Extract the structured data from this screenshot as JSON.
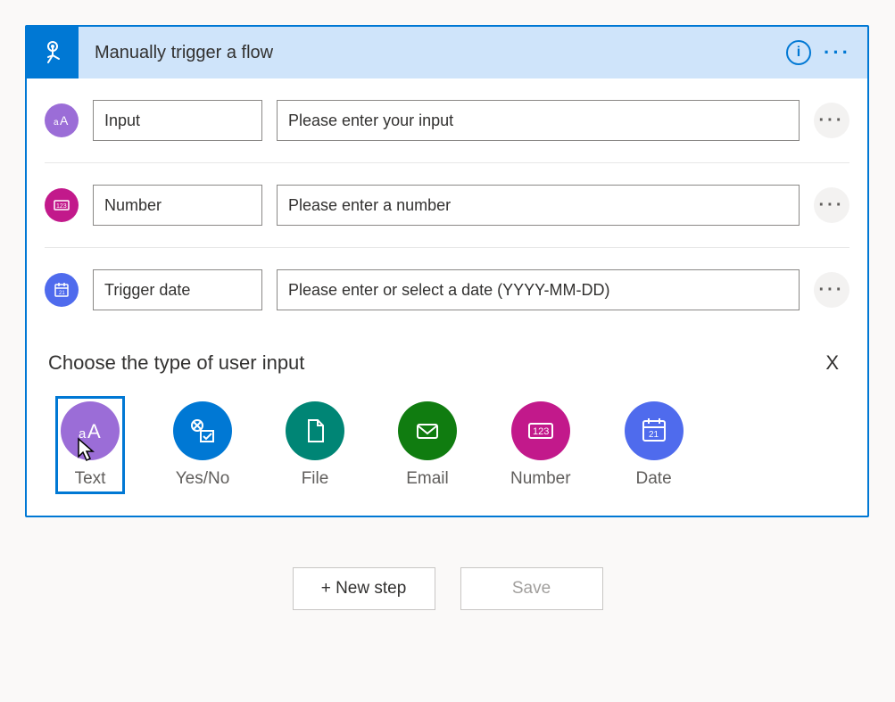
{
  "header": {
    "title": "Manually trigger a flow"
  },
  "inputs": [
    {
      "name": "Input",
      "placeholder": "Please enter your input",
      "badgeColor": "#9b6dd7",
      "type": "text"
    },
    {
      "name": "Number",
      "placeholder": "Please enter a number",
      "badgeColor": "#c2198b",
      "type": "number"
    },
    {
      "name": "Trigger date",
      "placeholder": "Please enter or select a date (YYYY-MM-DD)",
      "badgeColor": "#4f6bed",
      "type": "date"
    }
  ],
  "chooser": {
    "title": "Choose the type of user input",
    "close": "X",
    "options": [
      {
        "label": "Text",
        "color": "#9b6dd7",
        "type": "text",
        "selected": true
      },
      {
        "label": "Yes/No",
        "color": "#0078d4",
        "type": "yesno"
      },
      {
        "label": "File",
        "color": "#008575",
        "type": "file"
      },
      {
        "label": "Email",
        "color": "#107c10",
        "type": "email"
      },
      {
        "label": "Number",
        "color": "#c2198b",
        "type": "number"
      },
      {
        "label": "Date",
        "color": "#4f6bed",
        "type": "date"
      }
    ]
  },
  "footer": {
    "newStep": "+ New step",
    "save": "Save"
  }
}
